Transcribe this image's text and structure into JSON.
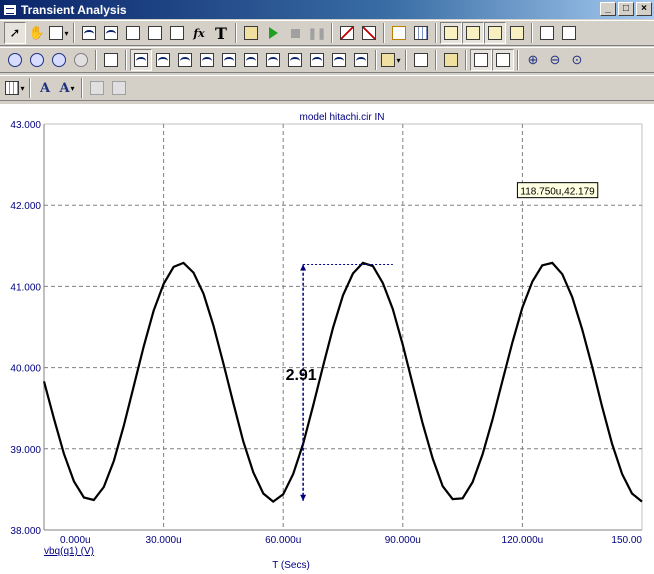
{
  "window": {
    "title": "Transient Analysis",
    "minimize_glyph": "_",
    "maximize_glyph": "□",
    "close_glyph": "×"
  },
  "toolbar": {
    "text_tool_glyph": "T",
    "function_glyph": "fx",
    "font_glyph": "A"
  },
  "chart_data": {
    "type": "line",
    "title": "model hitachi.cir IN",
    "xlabel": "T (Secs)",
    "series_label": "vbq(q1) (V)",
    "xlim": [
      0,
      150
    ],
    "ylim": [
      38.0,
      43.0
    ],
    "x_unit": "u",
    "x_ticks": [
      0,
      30,
      60,
      90,
      120,
      150
    ],
    "x_tick_labels": [
      "0.000u",
      "30.000u",
      "60.000u",
      "90.000u",
      "120.000u",
      "150.00"
    ],
    "y_ticks": [
      38.0,
      39.0,
      40.0,
      41.0,
      42.0,
      43.0
    ],
    "y_tick_labels": [
      "38.000",
      "39.000",
      "40.000",
      "41.000",
      "42.000",
      "43.000"
    ],
    "grid": true,
    "series": [
      {
        "name": "vbq(q1) (V)",
        "x": [
          0,
          2.5,
          5,
          7.5,
          10,
          12.5,
          15,
          17.5,
          20,
          22.5,
          25,
          27.5,
          30,
          32.5,
          35,
          37.5,
          40,
          42.5,
          45,
          47.5,
          50,
          52.5,
          55,
          57.5,
          60,
          62.5,
          65,
          67.5,
          70,
          72.5,
          75,
          77.5,
          80,
          82.5,
          85,
          87.5,
          90,
          92.5,
          95,
          97.5,
          100,
          102.5,
          105,
          107.5,
          110,
          112.5,
          115,
          117.5,
          120,
          122.5,
          125,
          127.5,
          130,
          132.5,
          135,
          137.5,
          140,
          142.5,
          145,
          147.5,
          150
        ],
        "y": [
          39.83,
          39.37,
          38.94,
          38.6,
          38.4,
          38.37,
          38.53,
          38.85,
          39.28,
          39.77,
          40.26,
          40.7,
          41.03,
          41.24,
          41.29,
          41.17,
          40.91,
          40.52,
          40.05,
          39.56,
          39.09,
          38.71,
          38.45,
          38.35,
          38.44,
          38.69,
          39.06,
          39.53,
          40.02,
          40.49,
          40.89,
          41.16,
          41.29,
          41.25,
          41.04,
          40.72,
          40.28,
          39.79,
          39.31,
          38.88,
          38.54,
          38.38,
          38.39,
          38.59,
          38.93,
          39.36,
          39.84,
          40.31,
          40.74,
          41.06,
          41.26,
          41.29,
          41.15,
          40.87,
          40.47,
          40.01,
          39.52,
          39.06,
          38.69,
          38.45,
          38.35
        ]
      }
    ],
    "measurement": {
      "x": 65.0,
      "y_low": 38.36,
      "y_high": 41.27,
      "x_peak": 87.5,
      "delta_label": "2.91"
    },
    "cursor_readout": "118.750u,42.179",
    "colors": {
      "curve": "#000000",
      "axis_text": "#000080",
      "measure": "#000080",
      "grid": "#808080",
      "readout_bg": "#ffffe1"
    }
  }
}
